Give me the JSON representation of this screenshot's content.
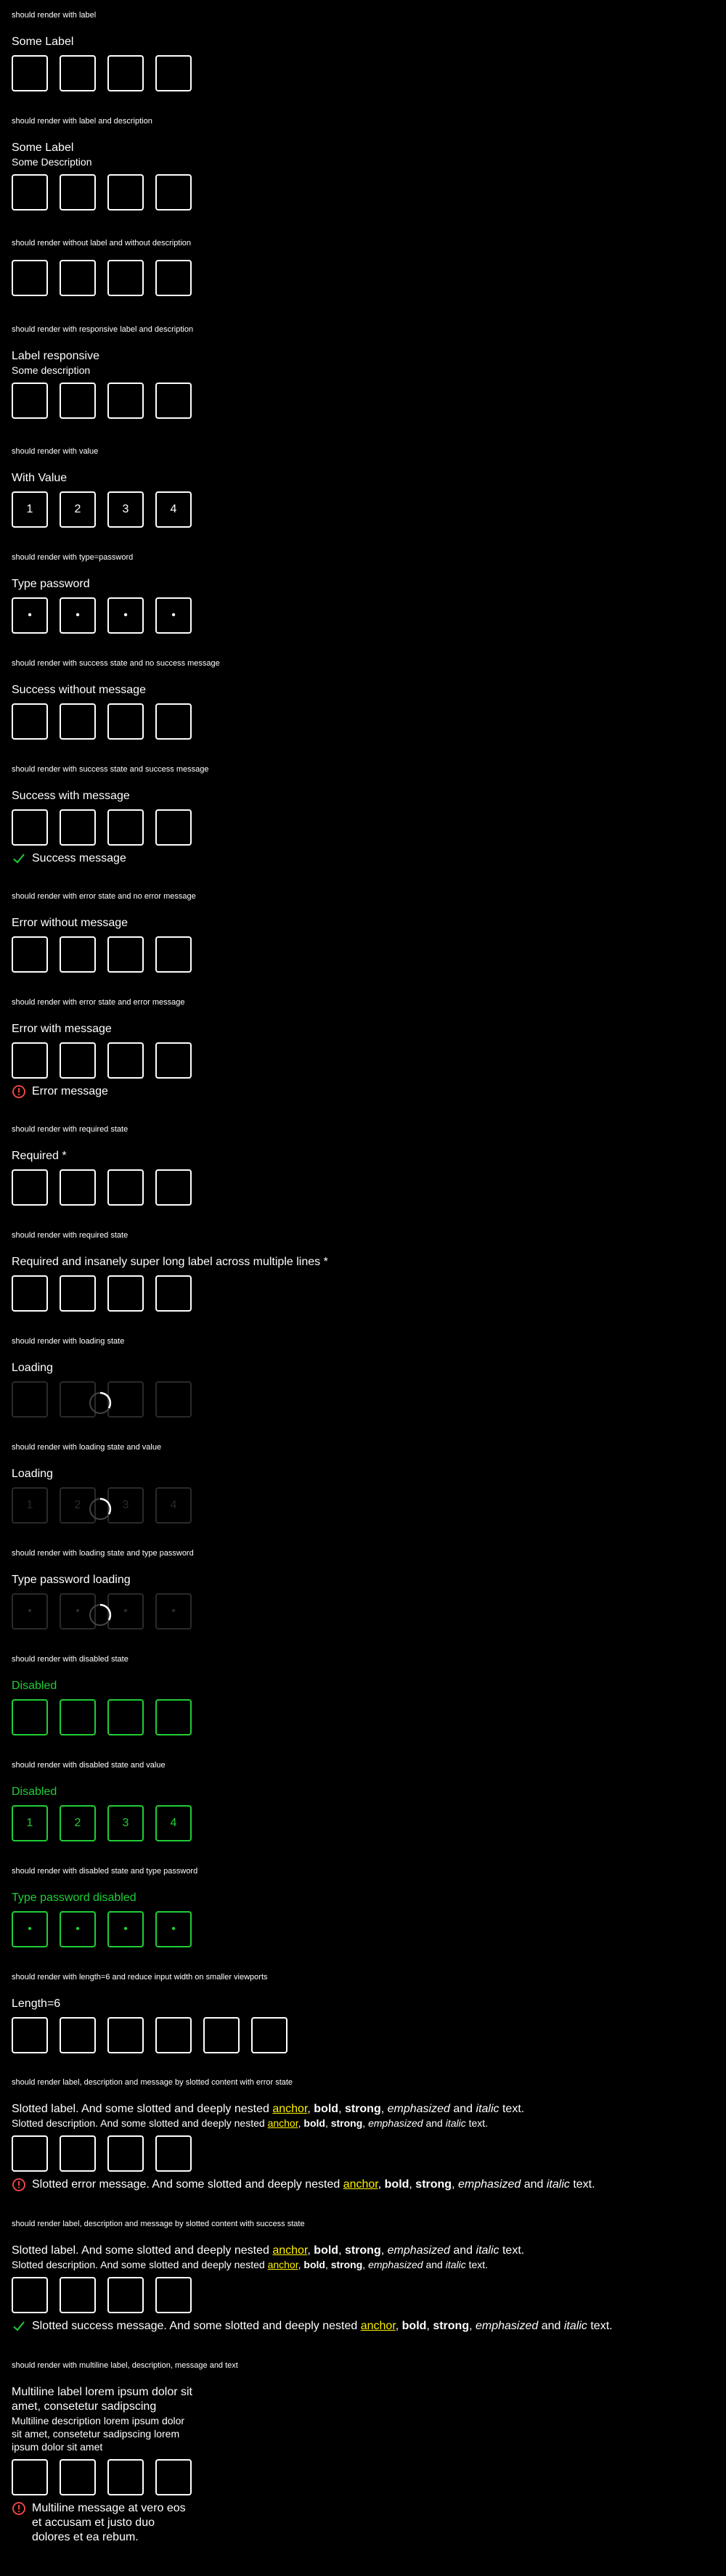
{
  "colors": {
    "success": "#1fce36",
    "error": "#ff4a4a",
    "anchor": "#fff200"
  },
  "s1": {
    "caption": "should render with label",
    "label": "Some Label"
  },
  "s2": {
    "caption": "should render with label and description",
    "label": "Some Label",
    "description": "Some Description"
  },
  "s3": {
    "caption": "should render without label and without description"
  },
  "s4": {
    "caption": "should render with responsive label and description",
    "label": "Label responsive",
    "description": "Some description"
  },
  "s5": {
    "caption": "should render with value",
    "label": "With Value",
    "values": [
      "1",
      "2",
      "3",
      "4"
    ]
  },
  "s6": {
    "caption": "should render with type=password",
    "label": "Type password",
    "dot": "•"
  },
  "s7": {
    "caption": "should render with success state and no success message",
    "label": "Success without message"
  },
  "s8": {
    "caption": "should render with success state and success message",
    "label": "Success with message",
    "message": "Success message"
  },
  "s9": {
    "caption": "should render with error state and no error message",
    "label": "Error without message"
  },
  "s10": {
    "caption": "should render with error state and error message",
    "label": "Error with message",
    "message": "Error message"
  },
  "s11": {
    "caption": "should render with required state",
    "label": "Required *"
  },
  "s12": {
    "caption": "should render with required state",
    "label": "Required and insanely super long label across multiple lines *"
  },
  "s13": {
    "caption": "should render with loading state",
    "label": "Loading"
  },
  "s14": {
    "caption": "should render with loading state and value",
    "label": "Loading",
    "values": [
      "1",
      "2",
      "3",
      "4"
    ]
  },
  "s15": {
    "caption": "should render with loading state and type password",
    "label": "Type password loading",
    "dot": "•"
  },
  "s16": {
    "caption": "should render with disabled state",
    "label": "Disabled"
  },
  "s17": {
    "caption": "should render with disabled state and value",
    "label": "Disabled",
    "values": [
      "1",
      "2",
      "3",
      "4"
    ]
  },
  "s18": {
    "caption": "should render with disabled state and type password",
    "label": "Type password disabled",
    "dot": "•"
  },
  "s19": {
    "caption": "should render with length=6 and reduce input width on smaller viewports",
    "label": "Length=6"
  },
  "s20": {
    "caption": "should render label, description and message by slotted content with error state",
    "label_pre": "Slotted label. And some slotted and deeply nested ",
    "desc_pre": "Slotted description. And some slotted and deeply nested ",
    "msg_pre": "Slotted error message. And some slotted and deeply nested ",
    "anchor": "anchor",
    "bold": "bold",
    "strong": "strong",
    "emph": "emphasized",
    "and": "and",
    "italic": "italic",
    "text": "text."
  },
  "s21": {
    "caption": "should render label, description and message by slotted content with success state",
    "label_pre": "Slotted label. And some slotted and deeply nested ",
    "desc_pre": "Slotted description. And some slotted and deeply nested ",
    "msg_pre": "Slotted success message. And some slotted and deeply nested ",
    "anchor": "anchor",
    "bold": "bold",
    "strong": "strong",
    "emph": "emphasized",
    "and": "and",
    "italic": "italic",
    "text": "text."
  },
  "s22": {
    "caption": "should render with multiline label, description, message and text",
    "label": "Multiline label lorem ipsum dolor sit amet, consetetur sadipscing",
    "description": "Multiline description lorem ipsum dolor sit amet, consetetur sadipscing lorem ipsum dolor sit amet",
    "message": "Multiline message at vero eos et accusam et justo duo dolores et ea rebum."
  }
}
